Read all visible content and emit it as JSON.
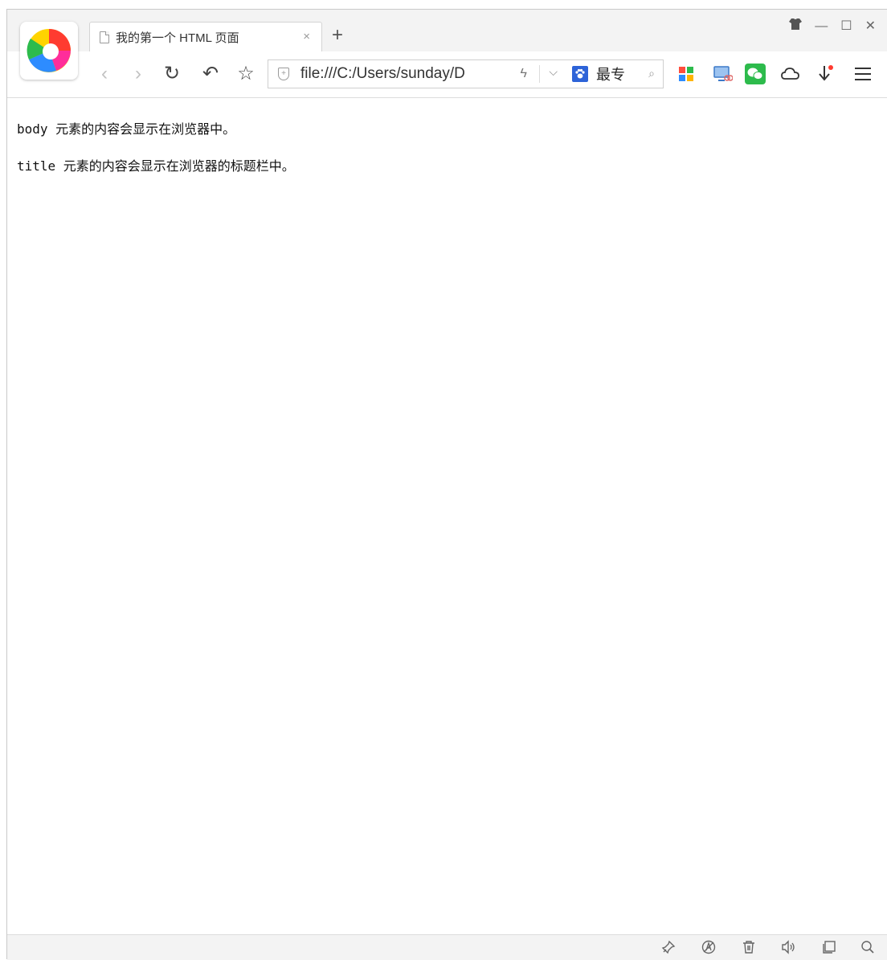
{
  "tab": {
    "title": "我的第一个 HTML 页面",
    "close": "×"
  },
  "new_tab": "+",
  "window_controls": {
    "minimize": "—",
    "maximize": "☐",
    "close": "✕"
  },
  "toolbar": {
    "back": "‹",
    "forward": "›",
    "reload": "↻",
    "undo": "↶",
    "bookmark": "☆"
  },
  "address": {
    "url": "file:///C:/Users/sunday/D",
    "bolt": "ϟ",
    "dropdown": "⌵"
  },
  "search": {
    "engine_icon": "paw-icon",
    "label": "最专",
    "mag": "⌕"
  },
  "content": {
    "line1": "body 元素的内容会显示在浏览器中。",
    "line2": "title 元素的内容会显示在浏览器的标题栏中。"
  },
  "colors": {
    "accent_green": "#2dbb4c",
    "accent_blue": "#2d63d8"
  }
}
